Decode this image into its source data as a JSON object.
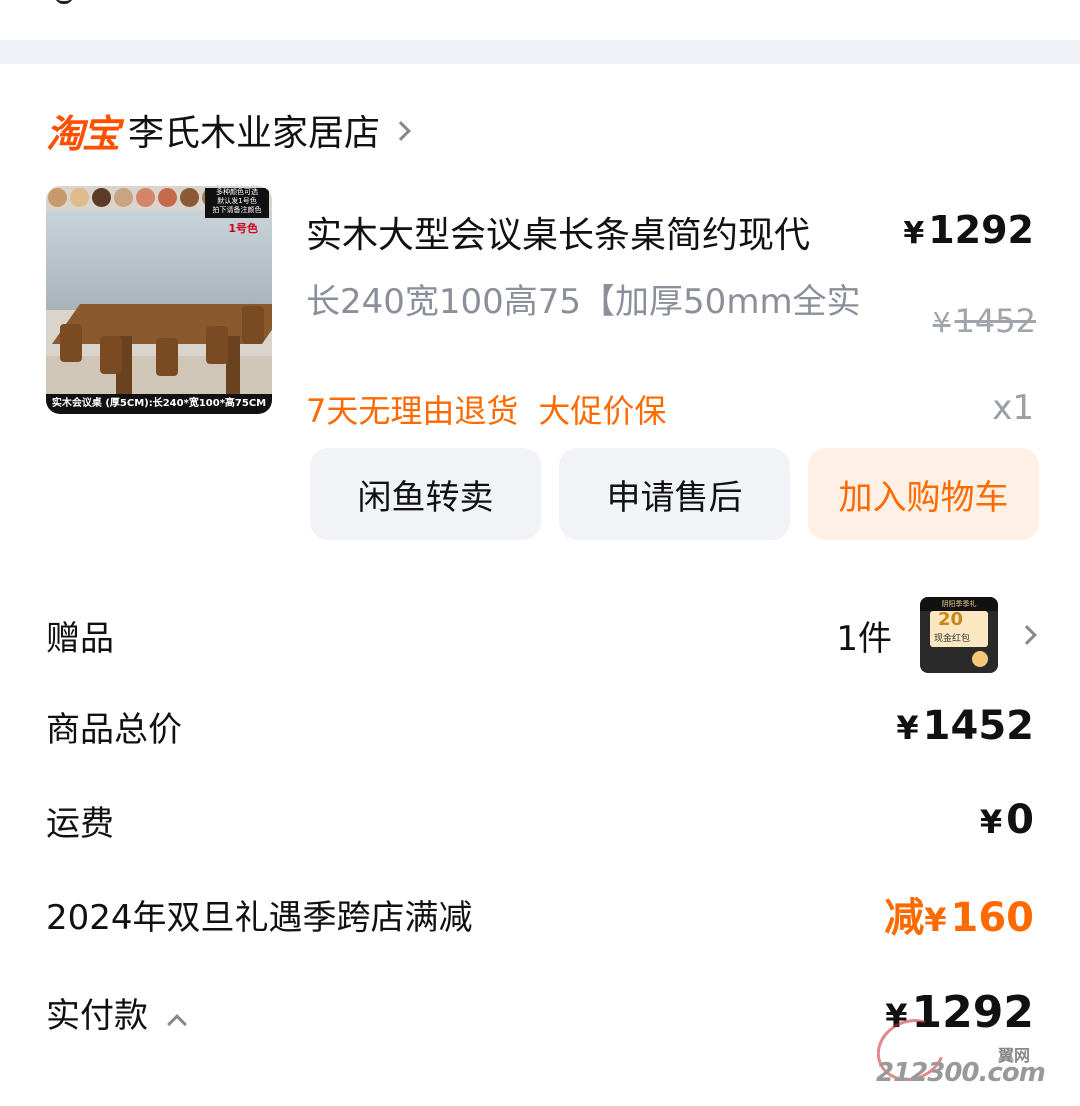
{
  "shop": {
    "logo": "淘宝",
    "name": "李氏木业家居店"
  },
  "item": {
    "title": "实木大型会议桌长条桌简约现代",
    "price_yen": "¥",
    "price": "1292",
    "spec": "长240宽100高75【加厚50mm全实",
    "orig_price_yen": "¥",
    "orig_price": "1452",
    "tags": [
      "7天无理由退货",
      "大促价保"
    ],
    "qty": "x1",
    "image": {
      "promo": [
        "多种颜色可选",
        "默认发1号色",
        "拍下请备注颜色"
      ],
      "color_tag": "1号色",
      "caption": "实木会议桌 (厚5CM):长240*宽100*高75CM",
      "swatch_colors": [
        "#c79a6b",
        "#e0b98d",
        "#5b3a28",
        "#caa383",
        "#d48468",
        "#c46a4b",
        "#8a5a36",
        "#a27a55"
      ]
    }
  },
  "actions": {
    "resell": "闲鱼转卖",
    "after_sales": "申请售后",
    "add_cart": "加入购物车"
  },
  "summary": {
    "gift_label": "赠品",
    "gift_count": "1件",
    "gift_thumb": {
      "top": "阴阳季季礼",
      "amount": "20",
      "label": "现金红包"
    },
    "total_label": "商品总价",
    "total_yen": "¥",
    "total_value": "1452",
    "shipping_label": "运费",
    "shipping_yen": "¥",
    "shipping_value": "0",
    "promo_label": "2024年双旦礼遇季跨店满减",
    "promo_prefix": "减",
    "promo_yen": "¥",
    "promo_value": "160",
    "paid_label": "实付款",
    "paid_yen": "¥",
    "paid_value": "1292"
  },
  "watermark": {
    "brand": "翼网",
    "domain": "212300.com"
  },
  "colors": {
    "accent": "#ff6a00",
    "taobao": "#ff5000",
    "muted": "#8a8f99"
  }
}
